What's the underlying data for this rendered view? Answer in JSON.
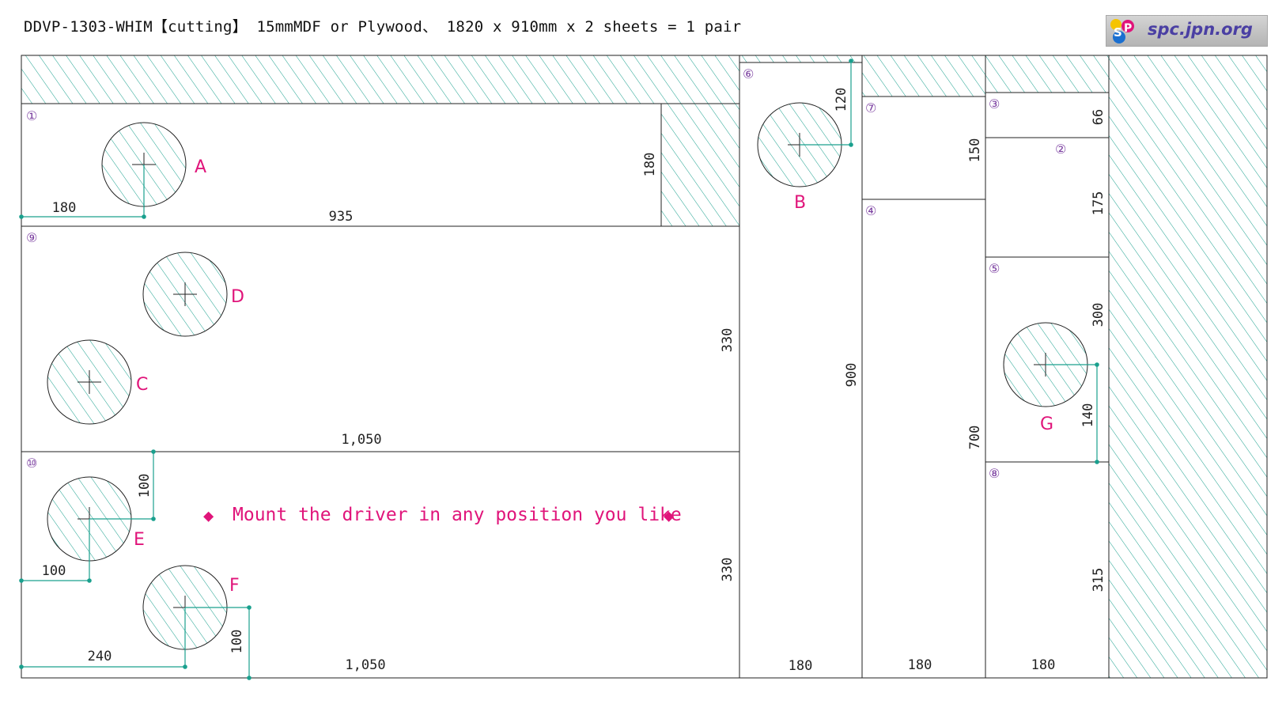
{
  "header": {
    "title": "DDVP-1303-WHIM【cutting】 15mmMDF or Plywood、 1820 x 910mm x 2 sheets = 1 pair",
    "logo_text": "spc.jpn.org"
  },
  "colors": {
    "outline": "#222222",
    "hatch": "#1aa08e",
    "dimension": "#1aa08e",
    "label": "#e0147a",
    "piece_number": "#7b3fa0",
    "text": "#222222"
  },
  "pieces": [
    {
      "id": "1",
      "label": "①"
    },
    {
      "id": "2",
      "label": "②"
    },
    {
      "id": "3",
      "label": "③"
    },
    {
      "id": "4",
      "label": "④"
    },
    {
      "id": "5",
      "label": "⑤"
    },
    {
      "id": "6",
      "label": "⑥"
    },
    {
      "id": "7",
      "label": "⑦"
    },
    {
      "id": "8",
      "label": "⑧"
    },
    {
      "id": "9",
      "label": "⑨"
    },
    {
      "id": "10",
      "label": "⑩"
    }
  ],
  "holes": [
    {
      "id": "A",
      "label": "A"
    },
    {
      "id": "B",
      "label": "B"
    },
    {
      "id": "C",
      "label": "C"
    },
    {
      "id": "D",
      "label": "D"
    },
    {
      "id": "E",
      "label": "E"
    },
    {
      "id": "F",
      "label": "F"
    },
    {
      "id": "G",
      "label": "G"
    }
  ],
  "dimensions": {
    "p1_hole_offset": "180",
    "p1_length": "935",
    "p1_height": "180",
    "p6_hole_offset": "120",
    "p7_height": "150",
    "p3_height": "66",
    "p2_height": "175",
    "p5_height": "300",
    "p9_height": "330",
    "p6_height": "900",
    "p4_height": "700",
    "p5_hole_offset": "140",
    "p9_length": "1,050",
    "p10_hole_e_y": "100",
    "p10_hole_e_x": "100",
    "p10_hole_f_y": "100",
    "p10_hole_f_x": "240",
    "p10_length": "1,050",
    "p10_height": "330",
    "p8_height": "315",
    "p6_width": "180",
    "p4_width": "180",
    "p8_width": "180"
  },
  "note": {
    "marker_left": "◆",
    "text": "Mount the driver in any position you like",
    "marker_right": "◆"
  }
}
